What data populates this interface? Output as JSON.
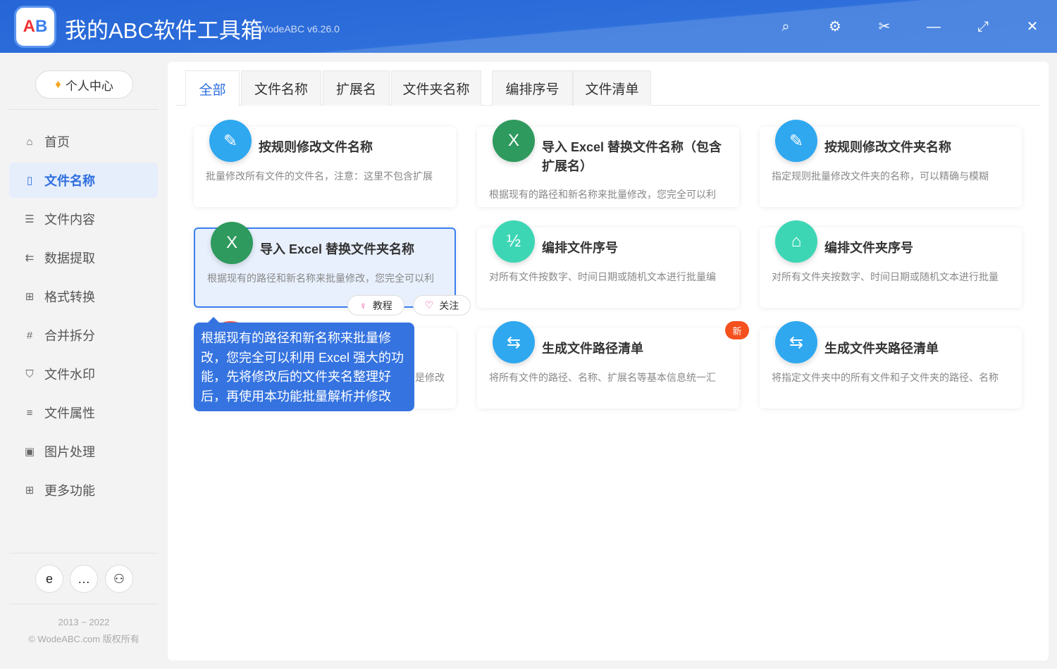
{
  "header": {
    "logo_text": "AB",
    "title": "我的ABC软件工具箱",
    "version": "WodeABC v6.26.0"
  },
  "sidebar": {
    "profile_label": "个人中心",
    "items": [
      {
        "label": "首页",
        "icon": "home-icon",
        "glyph": "⌂"
      },
      {
        "label": "文件名称",
        "icon": "file-icon",
        "glyph": "▯"
      },
      {
        "label": "文件内容",
        "icon": "list-icon",
        "glyph": "☰"
      },
      {
        "label": "数据提取",
        "icon": "extract-icon",
        "glyph": "⇇"
      },
      {
        "label": "格式转换",
        "icon": "convert-icon",
        "glyph": "⊞"
      },
      {
        "label": "合并拆分",
        "icon": "hash-icon",
        "glyph": "#"
      },
      {
        "label": "文件水印",
        "icon": "shield-icon",
        "glyph": "⛉"
      },
      {
        "label": "文件属性",
        "icon": "properties-icon",
        "glyph": "≡"
      },
      {
        "label": "图片处理",
        "icon": "image-icon",
        "glyph": "▣"
      },
      {
        "label": "更多功能",
        "icon": "grid-icon",
        "glyph": "⊞"
      }
    ],
    "years": "2013 ~ 2022",
    "copyright": "© WodeABC.com 版权所有"
  },
  "tabs": [
    "全部",
    "文件名称",
    "扩展名",
    "文件夹名称",
    "编排序号",
    "文件清单"
  ],
  "cards": [
    {
      "title": "按规则修改文件名称",
      "desc": "批量修改所有文件的文件名，注意：这里不包含扩展",
      "color": "#2fa8f0"
    },
    {
      "title": "导入 Excel 替换文件名称（包含扩展名）",
      "desc": "根据现有的路径和新名称来批量修改，您完全可以利",
      "color": "#2e9a5e"
    },
    {
      "title": "按规则修改文件夹名称",
      "desc": "指定规则批量修改文件夹的名称，可以精确与模糊",
      "color": "#2fa8f0"
    },
    {
      "title": "导入 Excel 替换文件夹名称",
      "desc": "根据现有的路径和新名称来批量修改，您完全可以利",
      "color": "#2e9a5e"
    },
    {
      "title": "编排文件序号",
      "desc": "对所有文件按数字、时间日期或随机文本进行批量编",
      "color": "#3dd6b5"
    },
    {
      "title": "编排文件夹序号",
      "desc": "对所有文件夹按数字、时间日期或随机文本进行批量",
      "color": "#3dd6b5"
    },
    {
      "title": "",
      "desc": "是修改",
      "color": "#ee5a4a"
    },
    {
      "title": "生成文件路径清单",
      "desc": "将所有文件的路径、名称、扩展名等基本信息统一汇",
      "color": "#2fa8f0",
      "badge": "新"
    },
    {
      "title": "生成文件夹路径清单",
      "desc": "将指定文件夹中的所有文件和子文件夹的路径、名称",
      "color": "#2fa8f0"
    }
  ],
  "pills": {
    "tutorial": "教程",
    "follow": "关注"
  },
  "tooltip": "根据现有的路径和新名称来批量修改，您完全可以利用 Excel 强大的功能，先将修改后的文件夹名整理好后，再使用本功能批量解析并修改"
}
